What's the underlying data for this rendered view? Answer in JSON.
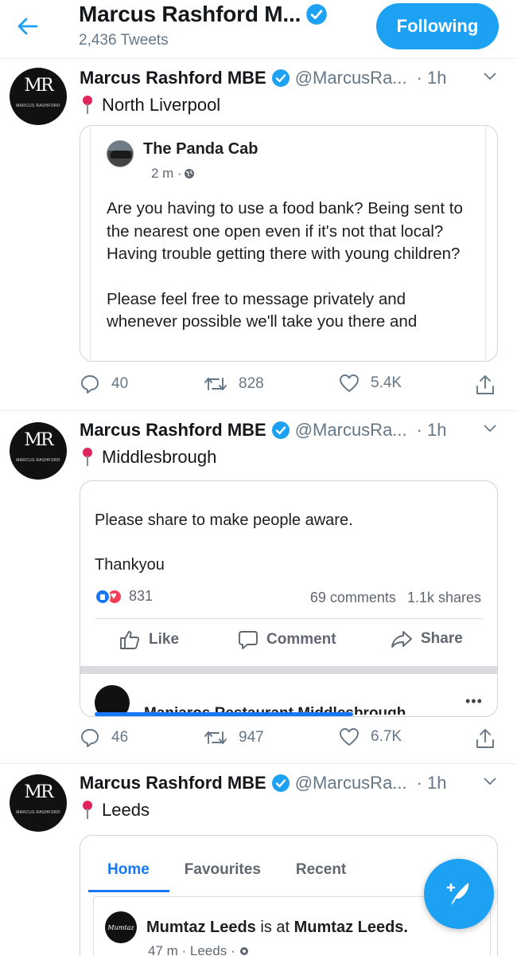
{
  "header": {
    "title": "Marcus Rashford M...",
    "tweet_count": "2,436 Tweets",
    "follow_label": "Following"
  },
  "colors": {
    "accent": "#1da1f2",
    "facebook_blue": "#1877f2",
    "pin_red": "#e0245e"
  },
  "tweets": [
    {
      "name": "Marcus Rashford MBE",
      "handle": "@MarcusRa...",
      "dot": "·",
      "time": "1h",
      "location": "North Liverpool",
      "avatar_monogram": "MR",
      "avatar_subtext": "MARCUS RASHFORD",
      "card": {
        "author": "The Panda Cab",
        "meta": "2 m ·",
        "paragraph_1": "Are you having to use a food bank? Being sent to the nearest one open even if it's not that local? Having trouble getting there with young children?",
        "paragraph_2": "Please feel free to message privately and whenever possible we'll take you there and"
      },
      "replies": "40",
      "retweets": "828",
      "likes": "5.4K"
    },
    {
      "name": "Marcus Rashford MBE",
      "handle": "@MarcusRa...",
      "dot": "·",
      "time": "1h",
      "location": "Middlesbrough",
      "avatar_monogram": "MR",
      "avatar_subtext": "MARCUS RASHFORD",
      "card": {
        "line_1": "Please share to make people aware.",
        "line_2": "Thankyou",
        "reactions": "831",
        "comments": "69 comments",
        "shares": "1.1k shares",
        "like_label": "Like",
        "comment_label": "Comment",
        "share_label": "Share",
        "next_post_author": "Manjaros Restaurant Middlesbrough",
        "more": "•••"
      },
      "replies": "46",
      "retweets": "947",
      "likes": "6.7K"
    },
    {
      "name": "Marcus Rashford MBE",
      "handle": "@MarcusRa...",
      "dot": "·",
      "time": "1h",
      "location": "Leeds",
      "avatar_monogram": "MR",
      "avatar_subtext": "MARCUS RASHFORD",
      "card": {
        "tabs": [
          "Home",
          "Favourites",
          "Recent"
        ],
        "page_name": "Mumtaz Leeds",
        "is_at": "is at",
        "place": "Mumtaz Leeds.",
        "meta": "47 m · Leeds ·",
        "avatar_text": "Mumtaz"
      }
    }
  ],
  "compose_icon": "compose-feather-icon"
}
